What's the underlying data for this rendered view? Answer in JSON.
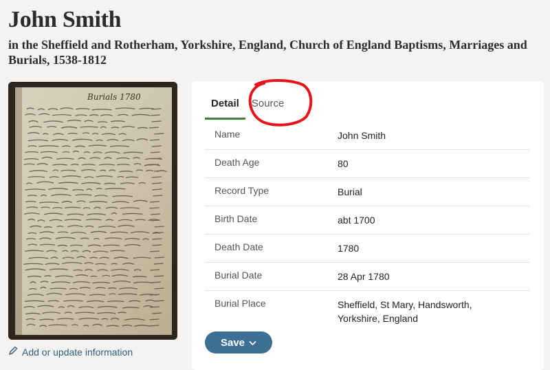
{
  "header": {
    "title": "John Smith",
    "subtitle": "in the Sheffield and Rotherham, Yorkshire, England, Church of England Baptisms, Marriages and Burials, 1538-1812"
  },
  "sidebar": {
    "image_alt": "Burials document scan",
    "page_heading": "Burials 1780",
    "add_link": "Add or update information",
    "add_link_icon": "pencil-icon"
  },
  "tabs": [
    {
      "label": "Detail",
      "active": true
    },
    {
      "label": "Source",
      "active": false
    }
  ],
  "details": [
    {
      "label": "Name",
      "value": "John Smith"
    },
    {
      "label": "Death Age",
      "value": "80"
    },
    {
      "label": "Record Type",
      "value": "Burial"
    },
    {
      "label": "Birth Date",
      "value": "abt 1700"
    },
    {
      "label": "Death Date",
      "value": "1780"
    },
    {
      "label": "Burial Date",
      "value": "28 Apr 1780"
    },
    {
      "label": "Burial Place",
      "value": "Sheffield, St Mary, Handsworth, Yorkshire, England"
    }
  ],
  "save_button": {
    "label": "Save",
    "icon": "chevron-down-icon"
  },
  "colors": {
    "accent_green": "#3e7f3a",
    "button_blue": "#3d6f94",
    "link_blue": "#2f5e83",
    "annotation_red": "#e8141b"
  }
}
